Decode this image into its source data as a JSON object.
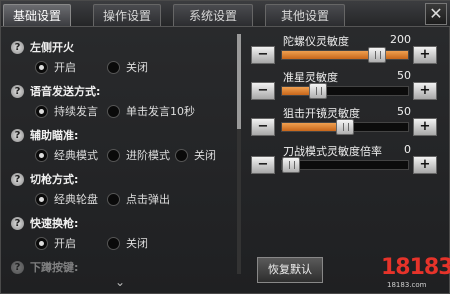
{
  "tabs": [
    {
      "label": "基础设置",
      "active": true
    },
    {
      "label": "操作设置",
      "active": false
    },
    {
      "label": "系统设置",
      "active": false
    },
    {
      "label": "其他设置",
      "active": false
    }
  ],
  "close_icon": "close-icon",
  "settings": [
    {
      "title": "左侧开火",
      "options": [
        "开启",
        "关闭"
      ],
      "selected": 0
    },
    {
      "title": "语音发送方式:",
      "options": [
        "持续发言",
        "单击发言10秒"
      ],
      "selected": 0
    },
    {
      "title": "辅助瞄准:",
      "options": [
        "经典模式",
        "进阶模式",
        "关闭"
      ],
      "selected": 0
    },
    {
      "title": "切枪方式:",
      "options": [
        "经典轮盘",
        "点击弹出"
      ],
      "selected": 0
    },
    {
      "title": "快速换枪:",
      "options": [
        "开启",
        "关闭"
      ],
      "selected": 0
    },
    {
      "title": "下蹲按键:",
      "options": [],
      "selected": null
    }
  ],
  "sliders": [
    {
      "label": "陀螺仪灵敏度",
      "value": "200",
      "fill_fraction": 1.0,
      "thumb_fraction": 0.8
    },
    {
      "label": "准星灵敏度",
      "value": "50",
      "fill_fraction": 0.25,
      "thumb_fraction": 0.25
    },
    {
      "label": "狙击开镜灵敏度",
      "value": "50",
      "fill_fraction": 0.5,
      "thumb_fraction": 0.5
    },
    {
      "label": "刀战模式灵敏度倍率",
      "value": "0",
      "fill_fraction": 0.0,
      "thumb_fraction": 0.0
    }
  ],
  "minus_label": "−",
  "plus_label": "+",
  "reset_button": "恢复默认",
  "watermark": {
    "text": "18183",
    "sub": "18183.com"
  },
  "colors": {
    "accent": "#e08a3c",
    "watermark": "#e6332a"
  }
}
